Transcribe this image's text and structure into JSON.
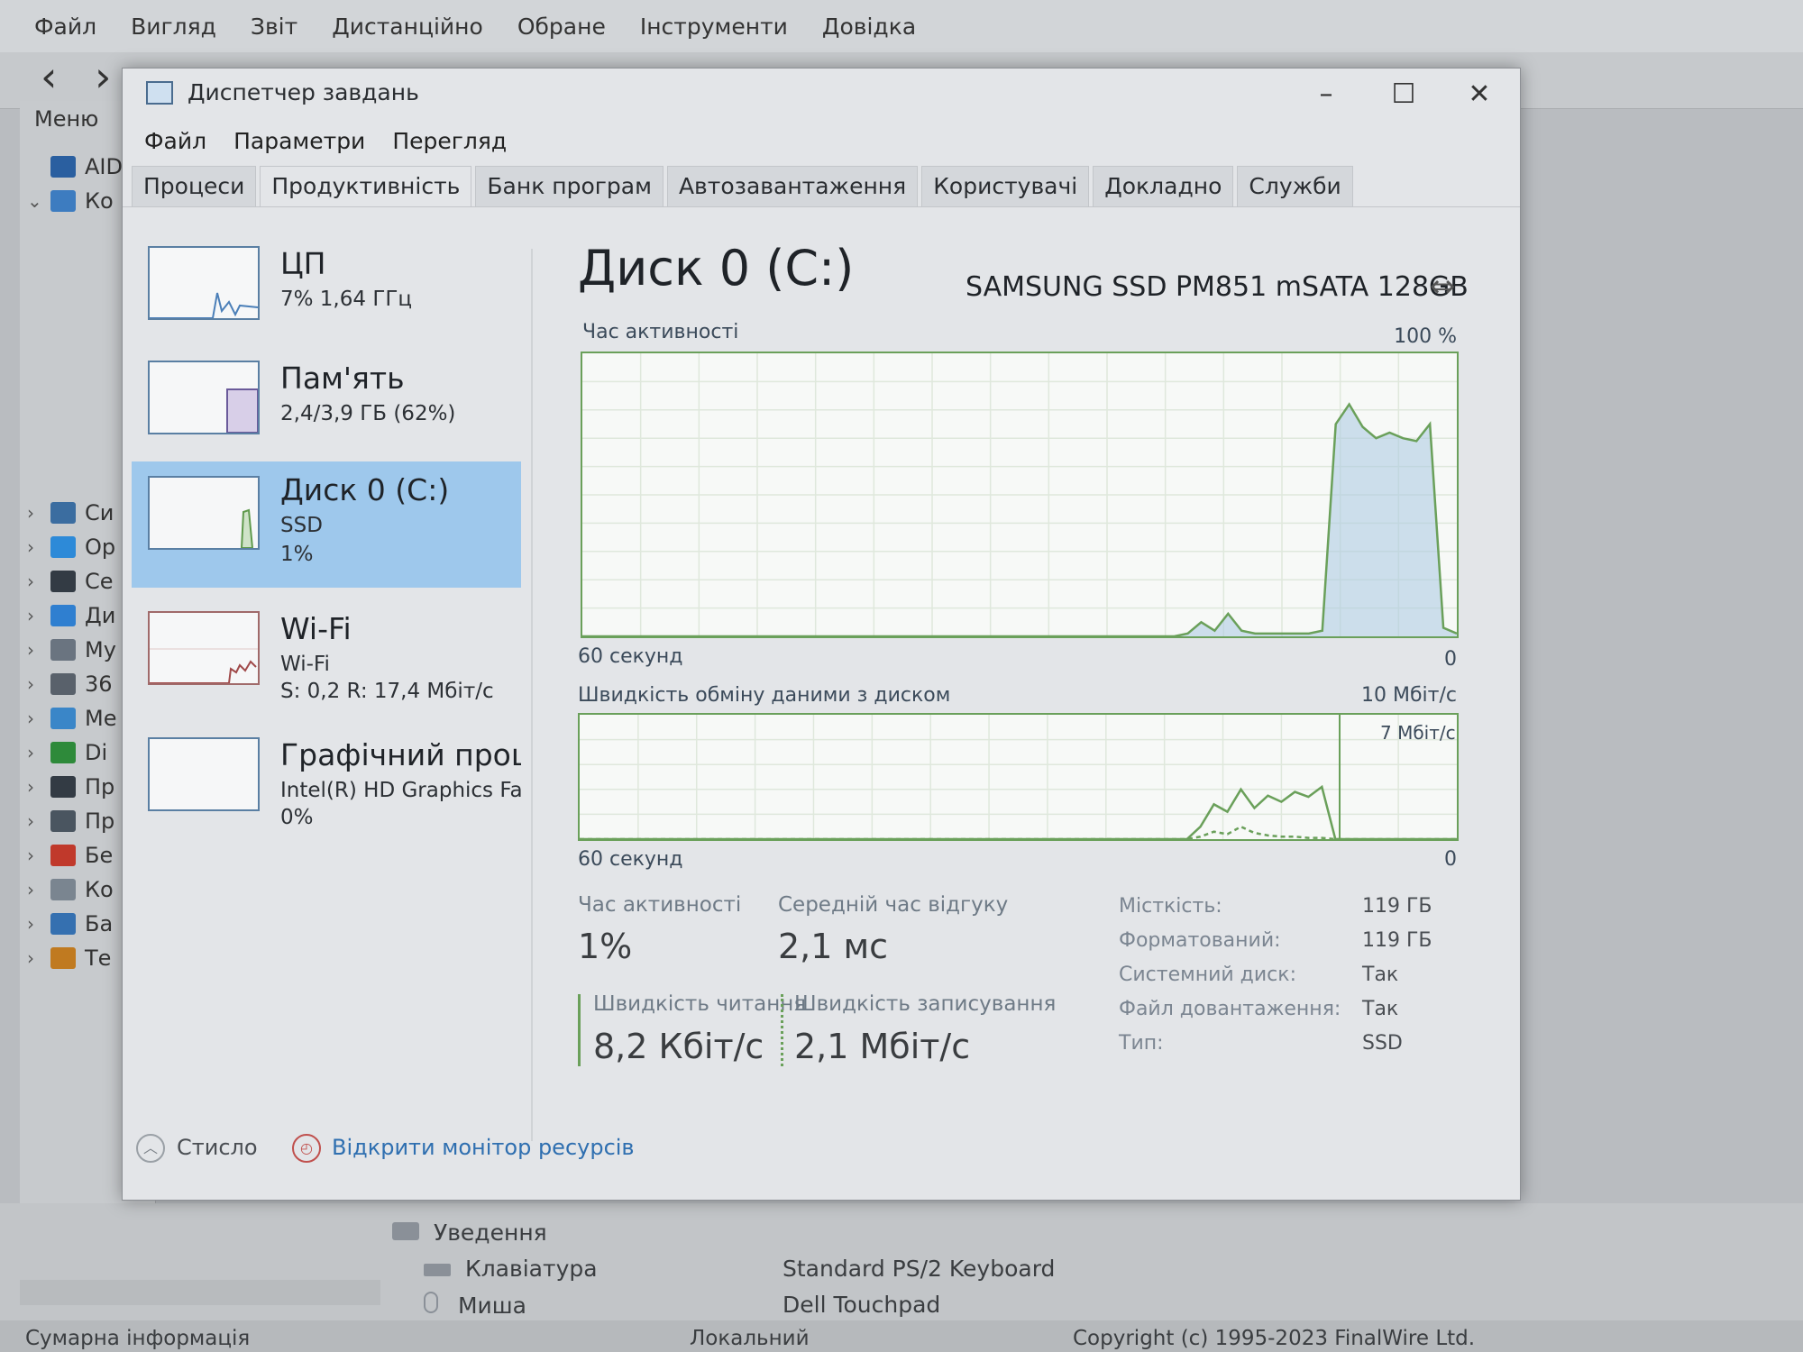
{
  "background_app": {
    "menu": [
      "Файл",
      "Вигляд",
      "Звіт",
      "Дистанційно",
      "Обране",
      "Інструменти",
      "Довідка"
    ],
    "side_menu_label": "Меню",
    "tree": [
      {
        "label": "AIDA",
        "icon": "aida64-icon",
        "color": "#2a5fa0"
      },
      {
        "label": "Ко",
        "icon": "computer-icon",
        "color": "#3d7cc0"
      },
      {
        "label": "Си",
        "icon": "motherboard-icon",
        "color": "#3b6da0"
      },
      {
        "label": "Ор",
        "icon": "windows-icon",
        "color": "#2d8ad8"
      },
      {
        "label": "Се",
        "icon": "server-icon",
        "color": "#333b44"
      },
      {
        "label": "Ди",
        "icon": "display-icon",
        "color": "#2f7fd0"
      },
      {
        "label": "Му",
        "icon": "multimedia-icon",
        "color": "#6a7480"
      },
      {
        "label": "36",
        "icon": "storage-icon",
        "color": "#59616b"
      },
      {
        "label": "Ме",
        "icon": "network-icon",
        "color": "#3a86c8"
      },
      {
        "label": "Di",
        "icon": "directx-icon",
        "color": "#2e8a3a"
      },
      {
        "label": "Пр",
        "icon": "devices-icon",
        "color": "#333b44"
      },
      {
        "label": "Пр",
        "icon": "software-icon",
        "color": "#4a5560"
      },
      {
        "label": "Бе",
        "icon": "security-icon",
        "color": "#c0392b"
      },
      {
        "label": "Ко",
        "icon": "config-icon",
        "color": "#7a8590"
      },
      {
        "label": "Ба",
        "icon": "database-icon",
        "color": "#3570b0"
      },
      {
        "label": "Те",
        "icon": "benchmark-icon",
        "color": "#c07a20"
      }
    ],
    "bottom": {
      "group": "Уведення",
      "rows": [
        {
          "label": "Клавіатура",
          "value": "Standard PS/2 Keyboard"
        },
        {
          "label": "Миша",
          "value": "Dell Touchpad"
        }
      ],
      "status_left": "Сумарна інформація",
      "status_mid": "Локальний",
      "copyright": "Copyright (c) 1995-2023 FinalWire Ltd."
    }
  },
  "taskmgr": {
    "title": "Диспетчер завдань",
    "menu": [
      "Файл",
      "Параметри",
      "Перегляд"
    ],
    "tabs": [
      "Процеси",
      "Продуктивність",
      "Банк програм",
      "Автозавантаження",
      "Користувачі",
      "Докладно",
      "Служби"
    ],
    "active_tab": 1,
    "perf_items": [
      {
        "title": "ЦП",
        "lines": [
          "7% 1,64 ГГц"
        ]
      },
      {
        "title": "Пам'ять",
        "lines": [
          "2,4/3,9 ГБ (62%)"
        ]
      },
      {
        "title": "Диск 0 (C:)",
        "lines": [
          "SSD",
          "1%"
        ]
      },
      {
        "title": "Wi-Fi",
        "lines": [
          "Wi-Fi",
          "S: 0,2  R: 17,4 Мбіт/с"
        ]
      },
      {
        "title": "Графічний процесор",
        "lines": [
          "Intel(R) HD Graphics Family",
          "0%"
        ]
      }
    ],
    "selected_item": 2,
    "disk": {
      "title": "Диск 0 (C:)",
      "model": "SAMSUNG SSD PM851 mSATA 128GB",
      "graph1_label": "Час активності",
      "graph1_max": "100 %",
      "graph1_left": "60 секунд",
      "graph1_right": "0",
      "graph2_label": "Швидкість обміну даними з диском",
      "graph2_max": "10 Мбіт/с",
      "graph2_marker": "7 Мбіт/с",
      "graph2_left": "60 секунд",
      "graph2_right": "0",
      "active_time_label": "Час активності",
      "active_time_value": "1%",
      "response_label": "Середній час відгуку",
      "response_value": "2,1 мс",
      "read_label": "Швидкість читання",
      "read_value": "8,2 Кбіт/с",
      "write_label": "Швидкість записування",
      "write_value": "2,1 Мбіт/с",
      "info": [
        {
          "key": "Місткість:",
          "value": "119 ГБ"
        },
        {
          "key": "Форматований:",
          "value": "119 ГБ"
        },
        {
          "key": "Системний диск:",
          "value": "Так"
        },
        {
          "key": "Файл довантаження:",
          "value": "Так"
        },
        {
          "key": "Тип:",
          "value": "SSD"
        }
      ],
      "activity_series": [
        0,
        0,
        0,
        0,
        0,
        0,
        0,
        0,
        0,
        0,
        0,
        0,
        0,
        0,
        0,
        0,
        0,
        0,
        0,
        0,
        0,
        0,
        0,
        0,
        0,
        0,
        0,
        0,
        0,
        0,
        0,
        0,
        0,
        0,
        0,
        0,
        0,
        0,
        0,
        0,
        0,
        0,
        0,
        0,
        0,
        1,
        5,
        2,
        8,
        2,
        1,
        1,
        1,
        1,
        1,
        2,
        75,
        82,
        74,
        70,
        72,
        70,
        69,
        75,
        3,
        1
      ],
      "transfer_read_series": [
        0,
        0,
        0,
        0,
        0,
        0,
        0,
        0,
        0,
        0,
        0,
        0,
        0,
        0,
        0,
        0,
        0,
        0,
        0,
        0,
        0,
        0,
        0,
        0,
        0,
        0,
        0,
        0,
        0,
        0,
        0,
        0,
        0,
        0,
        0,
        0,
        0,
        0,
        0,
        0,
        0,
        0,
        0,
        0,
        0,
        0,
        10,
        28,
        22,
        40,
        25,
        35,
        30,
        38,
        34,
        42,
        0,
        0,
        0,
        0,
        0,
        0,
        0,
        0,
        0,
        0
      ],
      "transfer_write_series": [
        0,
        0,
        0,
        0,
        0,
        0,
        0,
        0,
        0,
        0,
        0,
        0,
        0,
        0,
        0,
        0,
        0,
        0,
        0,
        0,
        0,
        0,
        0,
        0,
        0,
        0,
        0,
        0,
        0,
        0,
        0,
        0,
        0,
        0,
        0,
        0,
        0,
        0,
        0,
        0,
        0,
        0,
        0,
        0,
        0,
        0,
        2,
        6,
        4,
        10,
        5,
        3,
        2,
        2,
        1,
        1,
        0,
        0,
        0,
        0,
        0,
        0,
        0,
        0,
        0,
        0
      ]
    },
    "footer": {
      "collapse_label": "Стисло",
      "monitor_link": "Відкрити монітор ресурсів"
    },
    "colors": {
      "accent": "#9ec8ec",
      "graph_line": "#6aa05a",
      "link": "#2f6fb0"
    }
  }
}
